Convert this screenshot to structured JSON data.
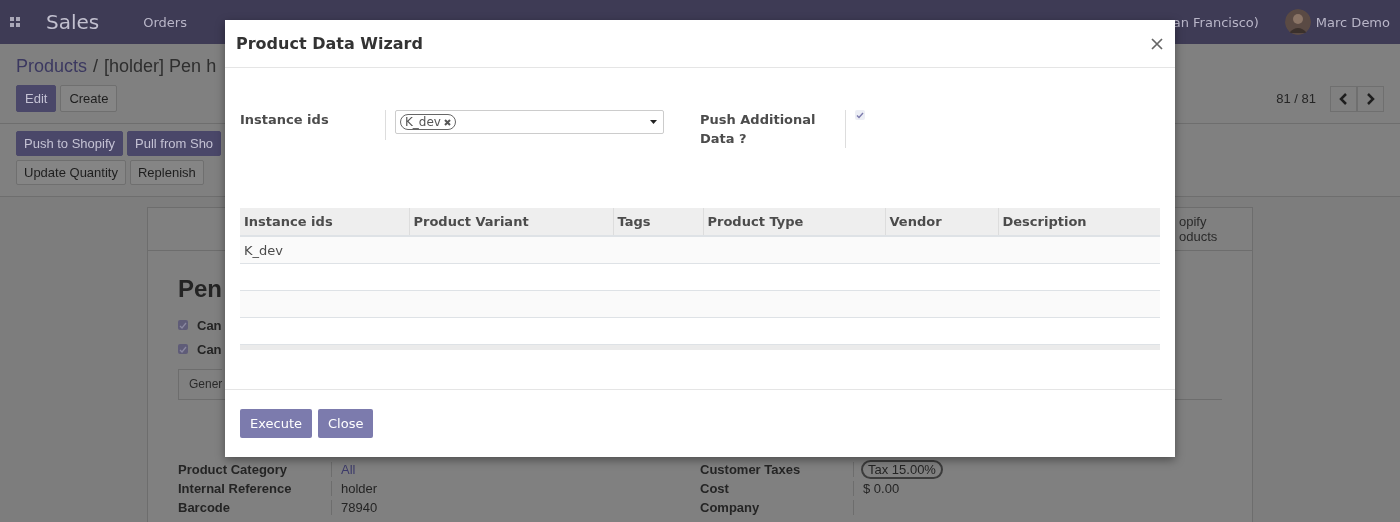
{
  "navbar": {
    "app": "Sales",
    "menu": [
      "Orders"
    ],
    "company": "an Francisco)",
    "user": "Marc Demo"
  },
  "breadcrumb": {
    "parent": "Products",
    "separator": "/",
    "current": "[holder] Pen h"
  },
  "actions": [
    {
      "label": "Edit",
      "kind": "primary"
    },
    {
      "label": "Create",
      "kind": "secondary"
    }
  ],
  "pager": "81 / 81",
  "header_rows": [
    [
      {
        "label": "Push to Shopify",
        "kind": "primary"
      },
      {
        "label": "Pull from Sho",
        "kind": "primary"
      }
    ],
    [
      {
        "label": "Update Quantity",
        "kind": "secondary"
      },
      {
        "label": "Replenish",
        "kind": "secondary"
      }
    ]
  ],
  "form": {
    "smart_button": [
      "opify",
      "oducts"
    ],
    "title": "Pen",
    "options": [
      {
        "label": "Can",
        "checked": true
      },
      {
        "label": "Can",
        "checked": true
      }
    ],
    "tab": "Gener",
    "fields_left": [
      {
        "label": "Product Category",
        "value": "All",
        "kind": "link"
      },
      {
        "label": "Internal Reference",
        "value": "holder",
        "kind": "text"
      },
      {
        "label": "Barcode",
        "value": "78940",
        "kind": "text"
      }
    ],
    "fields_right": [
      {
        "label": "Customer Taxes",
        "value": "Tax 15.00%",
        "kind": "tag"
      },
      {
        "label": "Cost",
        "value": "$ 0.00",
        "kind": "text"
      },
      {
        "label": "Company"
      }
    ]
  },
  "dialog": {
    "title": "Product Data Wizard",
    "instance_label": "Instance ids",
    "instance_tags": [
      "K_dev"
    ],
    "push_label": "Push Additional Data ?",
    "push_checked": true,
    "table": {
      "columns": [
        "Instance ids",
        "Product Variant",
        "Tags",
        "Product Type",
        "Vendor",
        "Description"
      ],
      "rows": [
        {
          "instance_ids": "K_dev"
        }
      ]
    },
    "buttons": [
      "Execute",
      "Close"
    ]
  }
}
